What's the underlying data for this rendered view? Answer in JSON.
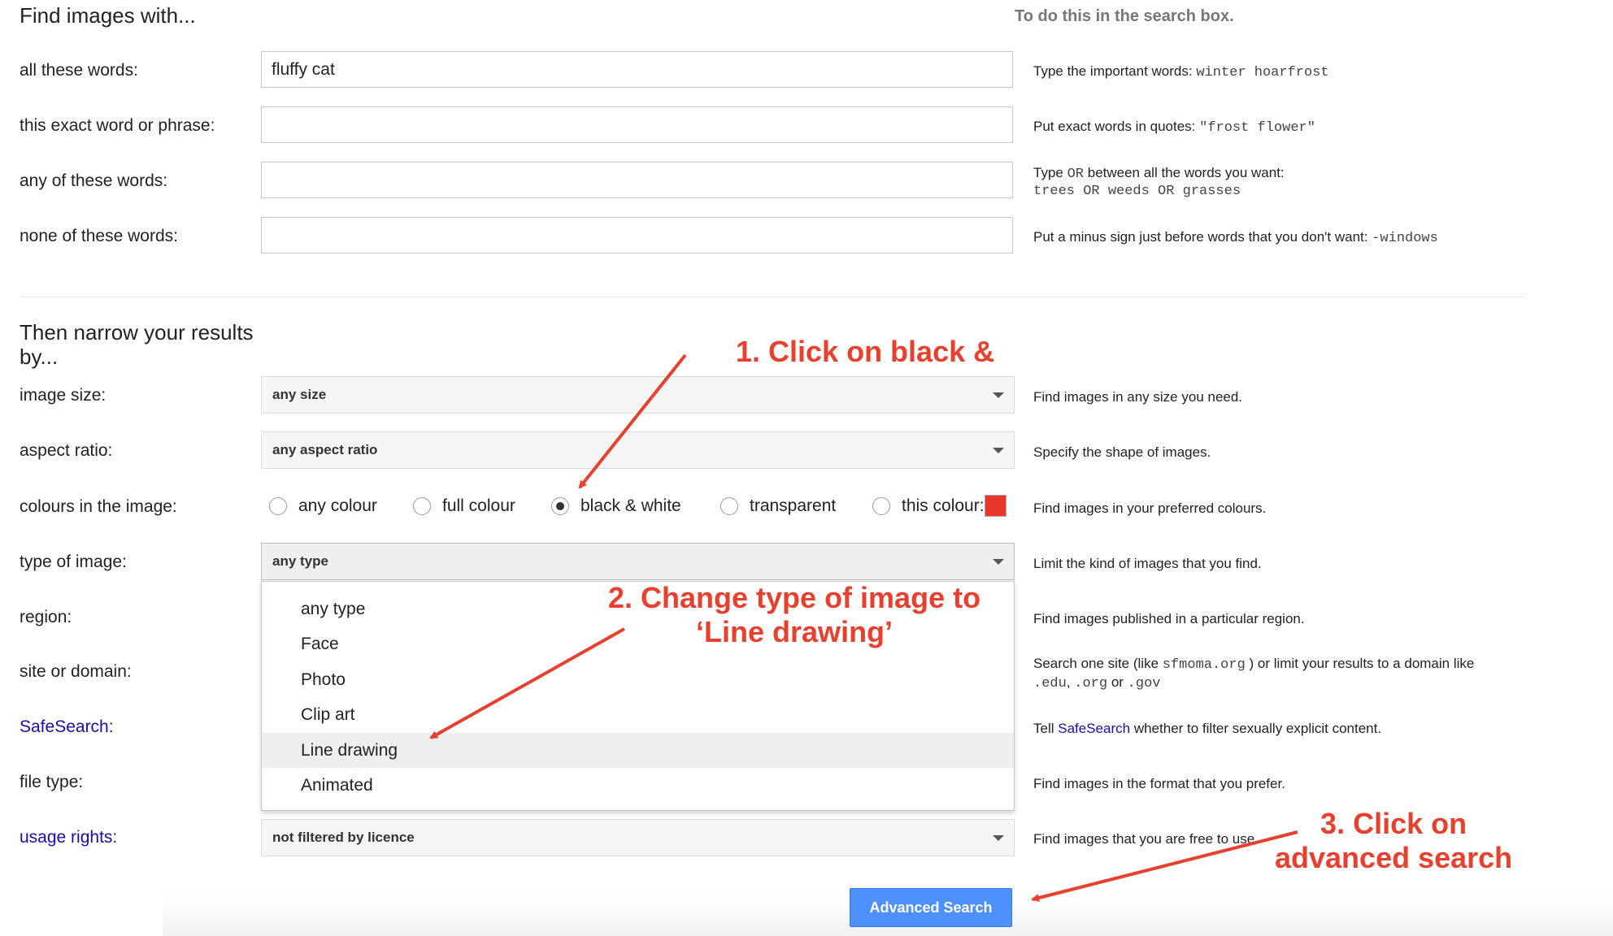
{
  "header": {
    "title": "Find images with...",
    "right_heading": "To do this in the search box."
  },
  "words_section": {
    "rows": [
      {
        "label": "all these words:",
        "value": "fluffy cat",
        "hint_text": "Type the important words:",
        "hint_code": "winter hoarfrost"
      },
      {
        "label": "this exact word or phrase:",
        "value": "",
        "hint_text": "Put exact words in quotes:",
        "hint_code": "\"frost flower\""
      },
      {
        "label": "any of these words:",
        "value": "",
        "hint_line1_text": "Type",
        "hint_line1_code": "OR",
        "hint_line1_rest": "between all the words you want:",
        "hint_line2": "trees OR weeds OR grasses"
      },
      {
        "label": "none of these words:",
        "value": "",
        "hint_text": "Put a minus sign just before words that you don't want:",
        "hint_code": "-windows"
      }
    ]
  },
  "narrow_section": {
    "title_line1": "Then narrow your results",
    "title_line2": "by...",
    "image_size": {
      "label": "image size:",
      "value": "any size",
      "hint": "Find images in any size you need."
    },
    "aspect_ratio": {
      "label": "aspect ratio:",
      "value": "any aspect ratio",
      "hint": "Specify the shape of images."
    },
    "colours": {
      "label": "colours in the image:",
      "options": [
        "any colour",
        "full colour",
        "black & white",
        "transparent",
        "this colour:"
      ],
      "selected": "black & white",
      "swatch_color": "#e8372a",
      "hint": "Find images in your preferred colours."
    },
    "type_of_image": {
      "label": "type of image:",
      "value": "any type",
      "hint": "Limit the kind of images that you find.",
      "dropdown_options": [
        "any type",
        "Face",
        "Photo",
        "Clip art",
        "Line drawing",
        "Animated"
      ],
      "highlighted": "Line drawing"
    },
    "region": {
      "label": "region:",
      "hint": "Find images published in a particular region."
    },
    "site_or_domain": {
      "label": "site or domain:",
      "hint_line1_a": "Search one site (like",
      "hint_line1_code": "sfmoma.org",
      "hint_line1_b": ") or limit your results to a domain like",
      "hint_line2_code1": ".edu",
      "hint_line2_code2": ".org",
      "hint_line2_or": "or",
      "hint_line2_code3": ".gov"
    },
    "safesearch": {
      "label_link": "SafeSearch",
      "label_suffix": ":",
      "hint_a": "Tell",
      "hint_link": "SafeSearch",
      "hint_b": "whether to filter sexually explicit content."
    },
    "file_type": {
      "label": "file type:",
      "hint": "Find images in the format that you prefer."
    },
    "usage_rights": {
      "label_link": "usage rights",
      "label_suffix": ":",
      "value": "not filtered by licence",
      "hint": "Find images that you are free to use."
    }
  },
  "advanced_search_button": "Advanced Search",
  "annotations": {
    "step1": "1. Click on black &",
    "step2_line1": "2. Change type of image to",
    "step2_line2": "‘Line drawing’",
    "step3_line1": "3. Click on",
    "step3_line2": "advanced search",
    "color": "#e8402e"
  },
  "colors": {
    "link": "#1a0dab",
    "button": "#4d90fe"
  }
}
